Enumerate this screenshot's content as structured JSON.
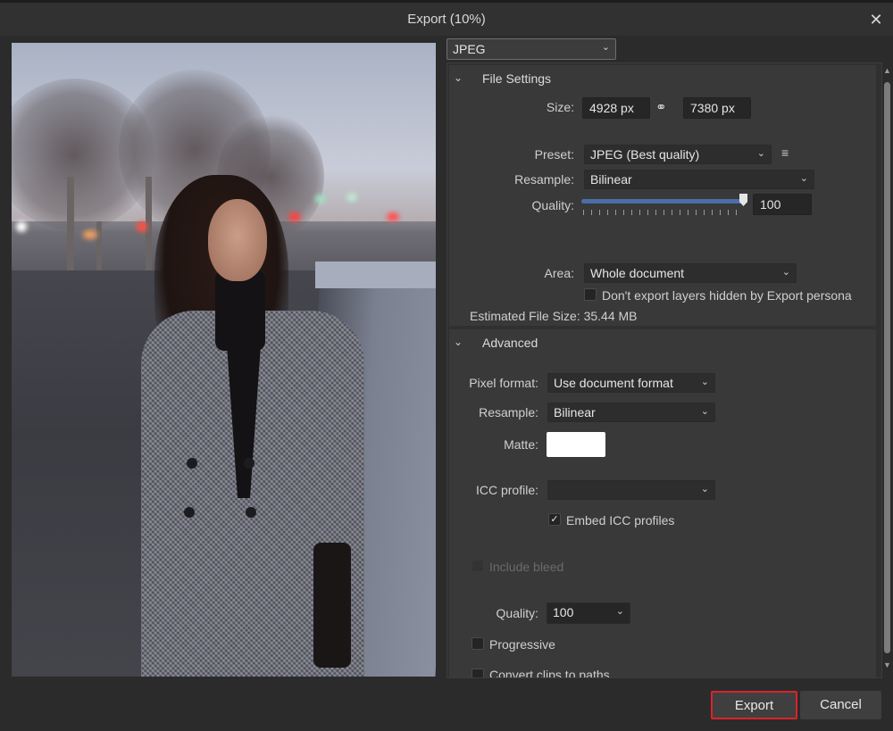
{
  "window": {
    "title": "Export (10%)",
    "close_icon": "close-icon"
  },
  "format": {
    "selected": "JPEG"
  },
  "file_settings": {
    "header": "File Settings",
    "size_label": "Size:",
    "width": "4928 px",
    "height": "7380 px",
    "link_icon": "link-icon",
    "preset_label": "Preset:",
    "preset_value": "JPEG (Best quality)",
    "menu_icon": "menu-icon",
    "resample_label": "Resample:",
    "resample_value": "Bilinear",
    "quality_label": "Quality:",
    "quality_value": "100",
    "quality_percent": 100,
    "area_label": "Area:",
    "area_value": "Whole document",
    "hidden_layers_label": "Don't export layers hidden by Export persona",
    "hidden_layers_checked": false,
    "estimated_size": "Estimated File Size: 35.44 MB"
  },
  "advanced": {
    "header": "Advanced",
    "pixel_format_label": "Pixel format:",
    "pixel_format_value": "Use document format",
    "resample_label": "Resample:",
    "resample_value": "Bilinear",
    "matte_label": "Matte:",
    "matte_color": "#ffffff",
    "icc_label": "ICC profile:",
    "icc_value": "",
    "embed_icc_label": "Embed ICC profiles",
    "embed_icc_checked": true,
    "include_bleed_label": "Include bleed",
    "include_bleed_checked": false,
    "quality_label": "Quality:",
    "quality_value": "100",
    "progressive_label": "Progressive",
    "progressive_checked": false,
    "convert_clips_label": "Convert clips to paths"
  },
  "actions": {
    "export_label": "Export",
    "cancel_label": "Cancel"
  },
  "colors": {
    "accent": "#4a6fa8",
    "highlight": "#d9232b"
  }
}
